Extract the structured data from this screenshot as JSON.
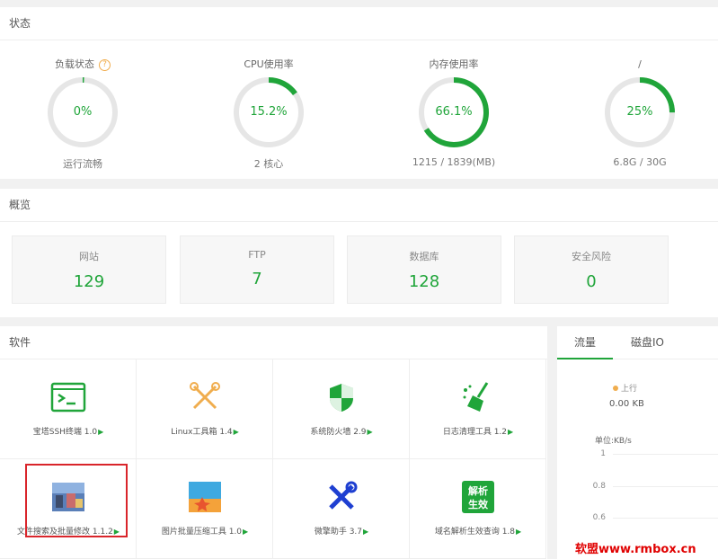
{
  "status": {
    "title": "状态",
    "gauges": [
      {
        "label": "负载状态",
        "value": "0%",
        "sub": "运行流畅",
        "percent": 0,
        "has_help": true
      },
      {
        "label": "CPU使用率",
        "value": "15.2%",
        "sub": "2 核心",
        "percent": 15.2,
        "has_help": false
      },
      {
        "label": "内存使用率",
        "value": "66.1%",
        "sub": "1215 / 1839(MB)",
        "percent": 66.1,
        "has_help": false
      },
      {
        "label": "/",
        "value": "25%",
        "sub": "6.8G / 30G",
        "percent": 25,
        "has_help": false
      }
    ],
    "help_glyph": "?"
  },
  "overview": {
    "title": "概览",
    "cards": [
      {
        "name": "网站",
        "value": "129"
      },
      {
        "name": "FTP",
        "value": "7"
      },
      {
        "name": "数据库",
        "value": "128"
      },
      {
        "name": "安全风险",
        "value": "0"
      }
    ]
  },
  "software": {
    "title": "软件",
    "play_glyph": "▶",
    "items": [
      {
        "name": "宝塔SSH终端 1.0",
        "icon": "terminal-icon"
      },
      {
        "name": "Linux工具箱 1.4",
        "icon": "tools-icon"
      },
      {
        "name": "系统防火墙 2.9",
        "icon": "shield-icon"
      },
      {
        "name": "日志清理工具 1.2",
        "icon": "broom-icon"
      },
      {
        "name": "文件搜索及批量修改 1.1.2",
        "icon": "photo-icon"
      },
      {
        "name": "图片批量压缩工具 1.0",
        "icon": "image-icon"
      },
      {
        "name": "微擎助手 3.7",
        "icon": "wrench-icon"
      },
      {
        "name": "域名解析生效查询 1.8",
        "icon": "dns-icon",
        "icon_text": [
          "解析",
          "生效"
        ]
      }
    ]
  },
  "traffic": {
    "tabs": [
      "流量",
      "磁盘IO"
    ],
    "active_tab": 0,
    "legend_up": "上行",
    "up_value": "0.00 KB",
    "unit_label": "单位:KB/s",
    "y_ticks": [
      "1",
      "0.8",
      "0.6"
    ]
  },
  "watermark": "软盟www.rmbox.cn",
  "colors": {
    "accent": "#20a53a",
    "track": "#e6e6e6",
    "highlight": "#d9252b"
  }
}
